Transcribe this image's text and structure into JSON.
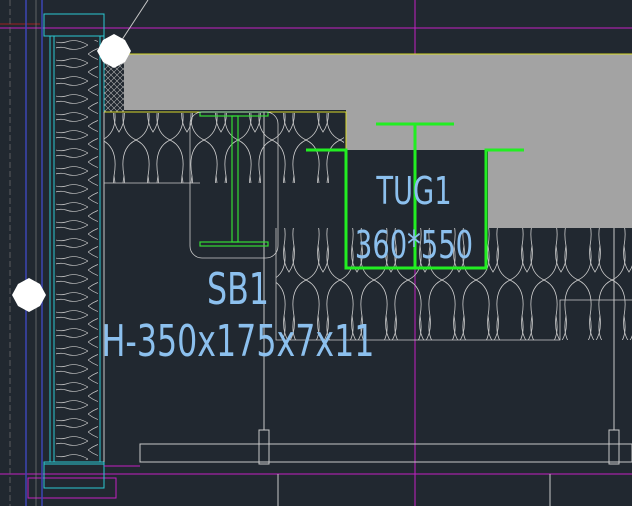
{
  "colors": {
    "background": "#212830",
    "slab_fill": "#a3a3a3",
    "dimension_line": "#c8c8c8",
    "magenta_line": "#c21fc2",
    "cyan_line": "#2bc9d2",
    "structure_green": "#22ee22",
    "beam_green": "#33dd33",
    "label_blue": "#8cc0ee",
    "slab_edge_yellow": "#d8d82a",
    "marker_white": "#ffffff"
  },
  "drawing": {
    "beam_sb1": {
      "name": "SB1",
      "section": "H-350x175x7x11"
    },
    "beam_tug1": {
      "name": "TUG1",
      "size": "360*550"
    }
  },
  "icons": [
    "grid-marker-icon",
    "grid-marker-icon"
  ]
}
